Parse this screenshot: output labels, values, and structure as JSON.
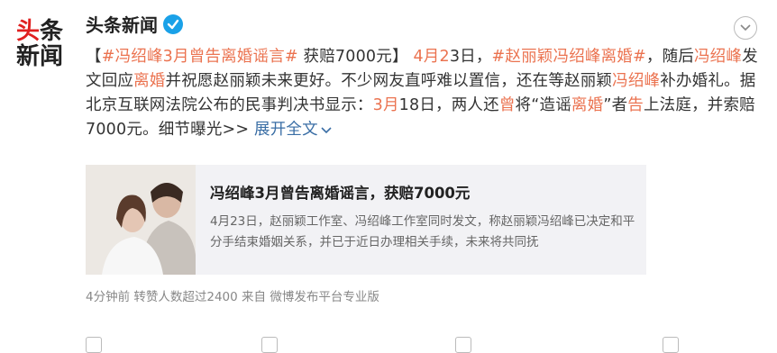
{
  "account": {
    "avatar_line1_red": "头",
    "avatar_line1_dark": "条",
    "avatar_line2": "新闻",
    "name": "头条新闻"
  },
  "post": {
    "segments": [
      {
        "text": "【",
        "style": "plain"
      },
      {
        "text": "#冯绍峰3月曾告离婚谣言#",
        "style": "topic"
      },
      {
        "text": " 获赔7000元】 ",
        "style": "plain"
      },
      {
        "text": "4月2",
        "style": "hl"
      },
      {
        "text": "3日，",
        "style": "plain"
      },
      {
        "text": "#赵丽颖冯绍峰离婚#",
        "style": "topic"
      },
      {
        "text": "，随后",
        "style": "plain"
      },
      {
        "text": "冯绍峰",
        "style": "hl"
      },
      {
        "text": "发文回应",
        "style": "plain"
      },
      {
        "text": "离婚",
        "style": "hl"
      },
      {
        "text": "并祝愿赵丽颖未来更好。不少网友直呼难以置信，还在等赵丽颖",
        "style": "plain"
      },
      {
        "text": "冯绍峰",
        "style": "hl"
      },
      {
        "text": "补办婚礼。据北京互联网法院公布的民事判决书显示：",
        "style": "plain"
      },
      {
        "text": "3月",
        "style": "hl"
      },
      {
        "text": "18日，两人还",
        "style": "plain"
      },
      {
        "text": "曾",
        "style": "hl"
      },
      {
        "text": "将“造谣",
        "style": "plain"
      },
      {
        "text": "离婚",
        "style": "hl"
      },
      {
        "text": "”者",
        "style": "plain"
      },
      {
        "text": "告",
        "style": "hl"
      },
      {
        "text": "上法庭，并索赔7000元。细节曝光>> ",
        "style": "plain"
      },
      {
        "text": "展开全文",
        "style": "link"
      }
    ]
  },
  "card": {
    "title": "冯绍峰3月曾告离婚谣言，获赔7000元",
    "desc": "4月23日，赵丽颖工作室、冯绍峰工作室同时发文，称赵丽颖冯绍峰已决定和平分手结束婚姻关系，并已于近日办理相关手续，未来将共同抚"
  },
  "meta": "4分钟前 转赞人数超过2400  来自 微博发布平台专业版",
  "colors": {
    "topic": "#eb7350",
    "link": "#3a6ea5",
    "verified": "#1aa1e8"
  }
}
